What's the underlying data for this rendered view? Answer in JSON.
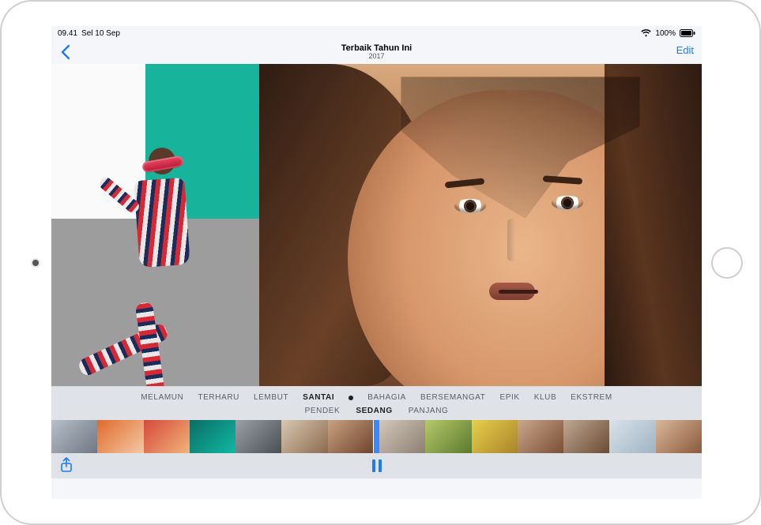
{
  "status": {
    "time": "09.41",
    "date": "Sel 10 Sep",
    "battery_pct": "100%"
  },
  "nav": {
    "title": "Terbaik Tahun Ini",
    "subtitle": "2017",
    "edit_label": "Edit"
  },
  "moods": {
    "items": [
      "MELAMUN",
      "TERHARU",
      "LEMBUT",
      "SANTAI",
      "BAHAGIA",
      "BERSEMANGAT",
      "EPIK",
      "KLUB",
      "EKSTREM"
    ],
    "selected_index": 3
  },
  "durations": {
    "items": [
      "PENDEK",
      "SEDANG",
      "PANJANG"
    ],
    "selected_index": 1
  },
  "thumbnails": [
    {
      "bg": "linear-gradient(135deg,#b7bfc8,#6e7884)"
    },
    {
      "bg": "linear-gradient(135deg,#e06a2b,#f3c9a4)"
    },
    {
      "bg": "linear-gradient(135deg,#d44a3a,#f1b37b)"
    },
    {
      "bg": "linear-gradient(135deg,#0a6e63,#11b7a3)"
    },
    {
      "bg": "linear-gradient(135deg,#9aa0a5,#4b4f54)"
    },
    {
      "bg": "linear-gradient(135deg,#d7c7b3,#8c6b4c)"
    },
    {
      "bg": "linear-gradient(135deg,#caa182,#6e432c)"
    },
    {
      "bg": "linear-gradient(135deg,#d2c7bb,#8d8073)"
    },
    {
      "bg": "linear-gradient(135deg,#b6c96a,#5a7a2e)"
    },
    {
      "bg": "linear-gradient(135deg,#e7cf4c,#a9852a)"
    },
    {
      "bg": "linear-gradient(135deg,#caa78a,#7a4f35)"
    },
    {
      "bg": "linear-gradient(135deg,#bfa893,#6a4b35)"
    },
    {
      "bg": "linear-gradient(135deg,#d9e3ea,#9fb3c2)"
    },
    {
      "bg": "linear-gradient(135deg,#d9b79a,#8a5a3c)"
    }
  ],
  "playhead_after_index": 6
}
